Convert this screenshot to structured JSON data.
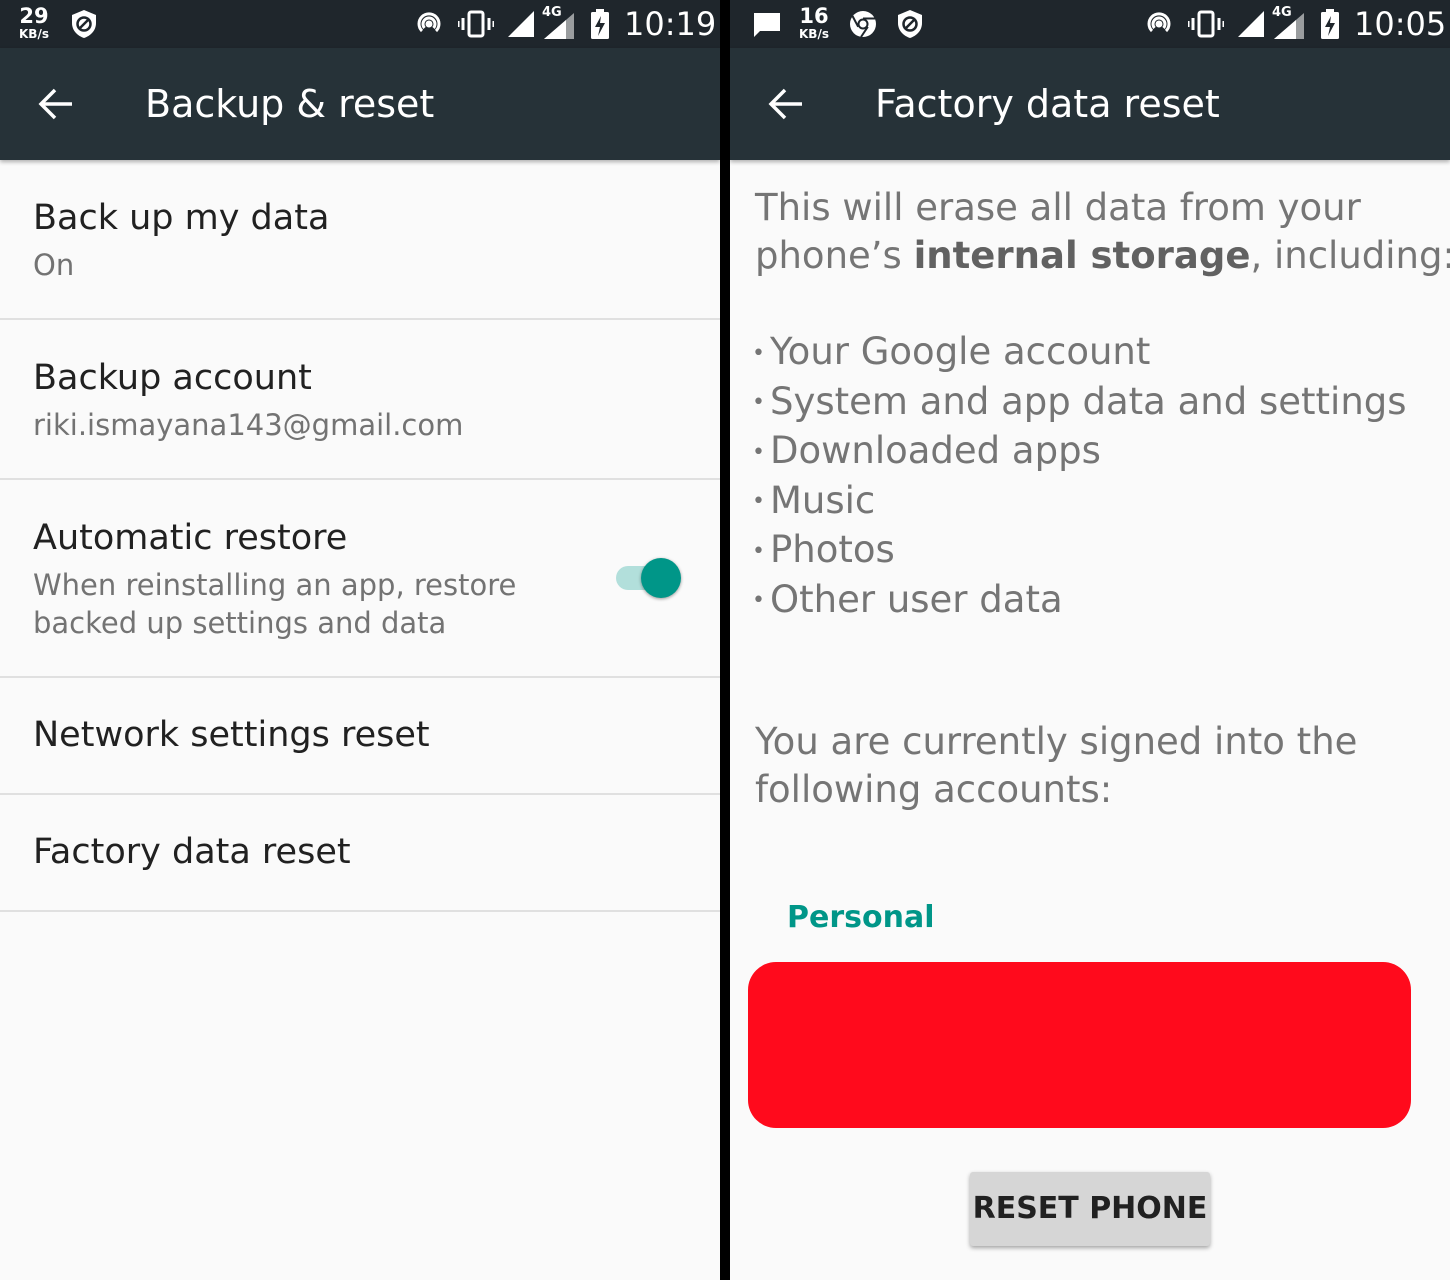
{
  "left": {
    "statusbar": {
      "net_speed": "29",
      "net_unit": "KB/s",
      "network": "4G",
      "time": "10:19",
      "icons": [
        "vpn-shield-icon",
        "hotspot-icon",
        "vibrate-icon",
        "signal-icon",
        "signal-4g-icon",
        "battery-charging-icon"
      ]
    },
    "appbar": {
      "title": "Backup & reset",
      "back_icon": "arrow-back-icon"
    },
    "items": [
      {
        "title": "Back up my data",
        "summary": "On"
      },
      {
        "title": "Backup account",
        "summary": "riki.ismayana143@gmail.com"
      },
      {
        "title": "Automatic restore",
        "summary_line1": "When reinstalling an app, restore",
        "summary_line2": "backed up settings and data",
        "toggle_on": true
      },
      {
        "title": "Network settings reset"
      },
      {
        "title": "Factory data reset"
      }
    ],
    "colors": {
      "appbar": "#263238",
      "accent": "#009688"
    }
  },
  "right": {
    "statusbar": {
      "net_speed": "16",
      "net_unit": "KB/s",
      "network": "4G",
      "time": "10:05",
      "icons": [
        "message-icon",
        "chrome-icon",
        "vpn-shield-icon",
        "hotspot-icon",
        "vibrate-icon",
        "signal-icon",
        "signal-4g-icon",
        "battery-charging-icon"
      ]
    },
    "appbar": {
      "title": "Factory data reset",
      "back_icon": "arrow-back-icon"
    },
    "intro_line1": "This will erase all data from your",
    "intro_line2_pre": "phone’s ",
    "intro_line2_bold": "internal storage",
    "intro_line2_post": ", including:",
    "bullet_char": "•",
    "bullets": [
      "Your Google account",
      "System and app data and settings",
      "Downloaded apps",
      "Music",
      "Photos",
      "Other user data"
    ],
    "signed_line1": "You are currently signed into the",
    "signed_line2": "following accounts:",
    "accounts_header": "Personal",
    "redacted_color": "#ff0a1c",
    "reset_button": "RESET PHONE"
  }
}
